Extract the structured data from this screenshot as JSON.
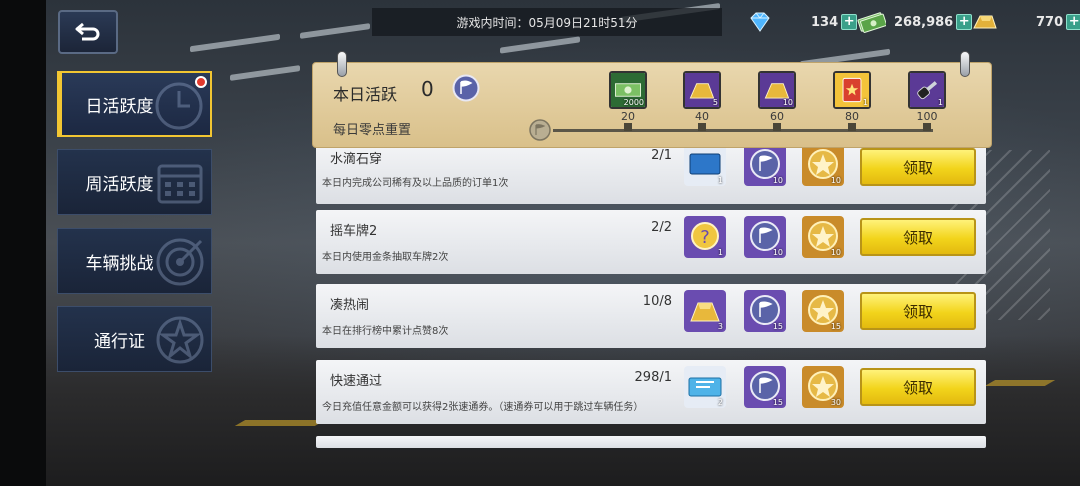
{
  "header": {
    "game_time": "游戏内时间：05月09日21时51分"
  },
  "currencies": [
    {
      "name": "diamond",
      "icon": "diamond-icon",
      "value": "134"
    },
    {
      "name": "cash",
      "icon": "cash-icon",
      "value": "268,986"
    },
    {
      "name": "gold",
      "icon": "gold-bar-icon",
      "value": "770"
    }
  ],
  "plus_label": "+",
  "tabs": [
    {
      "label": "日活跃度",
      "active": true,
      "badge": true
    },
    {
      "label": "周活跃度",
      "active": false,
      "badge": false
    },
    {
      "label": "车辆挑战",
      "active": false,
      "badge": false
    },
    {
      "label": "通行证",
      "active": false,
      "badge": false
    }
  ],
  "activity": {
    "title": "本日活跃",
    "value": "0",
    "reset_text": "每日零点重置",
    "progress_fraction": 0,
    "milestones": [
      {
        "points": "20",
        "icon": "cash-icon",
        "count": "2000"
      },
      {
        "points": "40",
        "icon": "gold-bar-icon",
        "count": "5"
      },
      {
        "points": "60",
        "icon": "gold-bar-icon",
        "count": "10"
      },
      {
        "points": "80",
        "icon": "ticket-icon",
        "count": "1"
      },
      {
        "points": "100",
        "icon": "car-key-icon",
        "count": "1"
      }
    ]
  },
  "tasks": [
    {
      "name": "水滴石穿",
      "progress": "2/1",
      "desc": "本日内完成公司稀有及以上品质的订单1次",
      "rewards": [
        {
          "icon": "blue-card-icon",
          "count": "1"
        },
        {
          "icon": "flag-medal-icon",
          "count": "10"
        },
        {
          "icon": "star-medal-icon",
          "count": "10"
        }
      ],
      "button": "领取"
    },
    {
      "name": "摇车牌2",
      "progress": "2/2",
      "desc": "本日内使用金条抽取车牌2次",
      "rewards": [
        {
          "icon": "mystery-icon",
          "count": "1"
        },
        {
          "icon": "flag-medal-icon",
          "count": "10"
        },
        {
          "icon": "star-medal-icon",
          "count": "10"
        }
      ],
      "button": "领取"
    },
    {
      "name": "凑热闹",
      "progress": "10/8",
      "desc": "本日在排行榜中累计点赞8次",
      "rewards": [
        {
          "icon": "gold-bar-icon",
          "count": "3"
        },
        {
          "icon": "flag-medal-icon",
          "count": "15"
        },
        {
          "icon": "star-medal-icon",
          "count": "15"
        }
      ],
      "button": "领取"
    },
    {
      "name": "快速通过",
      "progress": "298/1",
      "desc": "今日充值任意金额可以获得2张速通券。（速通券可以用于跳过车辆任务）",
      "rewards": [
        {
          "icon": "speed-ticket-icon",
          "count": "2"
        },
        {
          "icon": "flag-medal-icon",
          "count": "15"
        },
        {
          "icon": "star-medal-icon",
          "count": "30"
        }
      ],
      "button": "领取"
    }
  ]
}
